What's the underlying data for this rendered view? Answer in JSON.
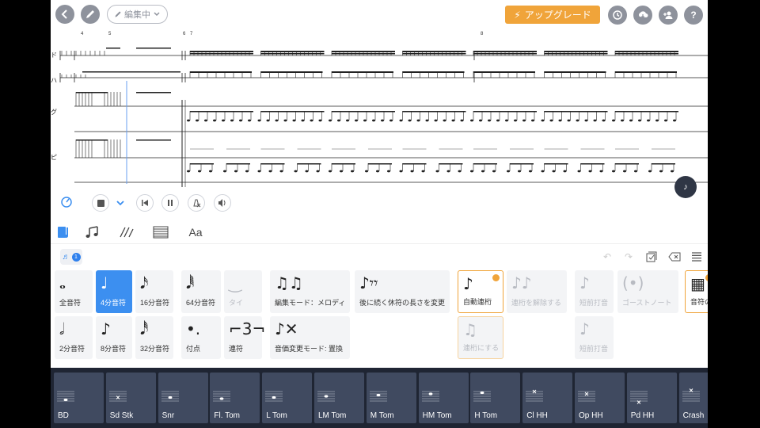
{
  "topbar": {
    "edit_mode_label": "編集中",
    "upgrade_label": "アップグレード",
    "colors": {
      "accent": "#f0a43a",
      "icon_gray": "#8e929c"
    }
  },
  "score": {
    "measure_numbers": [
      "4",
      "5",
      "6",
      "7",
      "8"
    ],
    "staff_labels": [
      "ド",
      "ハ",
      "グ",
      "ピ"
    ]
  },
  "playback": {
    "fab_label": "♪"
  },
  "palette_header": {
    "badge_count": "1"
  },
  "palette": {
    "row1": [
      {
        "glyph": "𝅝",
        "label": "全音符",
        "state": "normal"
      },
      {
        "glyph": "♩",
        "label": "4分音符",
        "state": "selected"
      },
      {
        "glyph": "𝅘𝅥𝅯",
        "label": "16分音符",
        "state": "normal"
      },
      {
        "glyph": "𝅘𝅥𝅱",
        "label": "64分音符",
        "state": "normal"
      },
      {
        "glyph": "‿",
        "label": "タイ",
        "state": "disabled"
      },
      {
        "glyph": "♫♫",
        "label": "編集モード：メロディ",
        "state": "normal"
      },
      {
        "glyph": "♪𝄾𝄾",
        "label": "後に続く休符の長さを変更",
        "state": "normal"
      },
      {
        "glyph": "♪",
        "label": "自動連桁",
        "state": "orange"
      },
      {
        "glyph": "♪♪",
        "label": "連桁を解除する",
        "state": "disabled"
      },
      {
        "glyph": "♪",
        "label": "短前打音",
        "state": "disabled"
      },
      {
        "glyph": "(•)",
        "label": "ゴーストノート",
        "state": "disabled"
      },
      {
        "glyph": "▦",
        "label": "音符の",
        "state": "orange"
      }
    ],
    "row2": [
      {
        "glyph": "𝅗𝅥",
        "label": "2分音符",
        "state": "normal"
      },
      {
        "glyph": "♪",
        "label": "8分音符",
        "state": "normal"
      },
      {
        "glyph": "𝅘𝅥𝅰",
        "label": "32分音符",
        "state": "normal"
      },
      {
        "glyph": "•.",
        "label": "付点",
        "state": "normal"
      },
      {
        "glyph": "⌐3¬",
        "label": "連符",
        "state": "normal"
      },
      {
        "glyph": "♪✕",
        "label": "音価変更モード: 置換",
        "state": "normal"
      },
      {
        "glyph": "♫",
        "label": "連桁にする",
        "state": "orange-dis"
      },
      {
        "glyph": "♪",
        "label": "短前打音",
        "state": "disabled"
      }
    ]
  },
  "drum_keys": [
    {
      "label": "BD",
      "head": "note",
      "pos": 3
    },
    {
      "label": "Sd Stk",
      "head": "x",
      "pos": 1
    },
    {
      "label": "Snr",
      "head": "note",
      "pos": 1
    },
    {
      "label": "Fl. Tom",
      "head": "note",
      "pos": 2
    },
    {
      "label": "L Tom",
      "head": "note",
      "pos": 1
    },
    {
      "label": "LM Tom",
      "head": "note",
      "pos": 0
    },
    {
      "label": "M Tom",
      "head": "note",
      "pos": -1
    },
    {
      "label": "HM Tom",
      "head": "note",
      "pos": -2
    },
    {
      "label": "H Tom",
      "head": "note",
      "pos": -3
    },
    {
      "label": "Cl HH",
      "head": "x",
      "pos": -4
    },
    {
      "label": "Op HH",
      "head": "x",
      "pos": -2
    },
    {
      "label": "Pd HH",
      "head": "x",
      "pos": 5
    },
    {
      "label": "Crash",
      "head": "x",
      "pos": -5
    }
  ]
}
